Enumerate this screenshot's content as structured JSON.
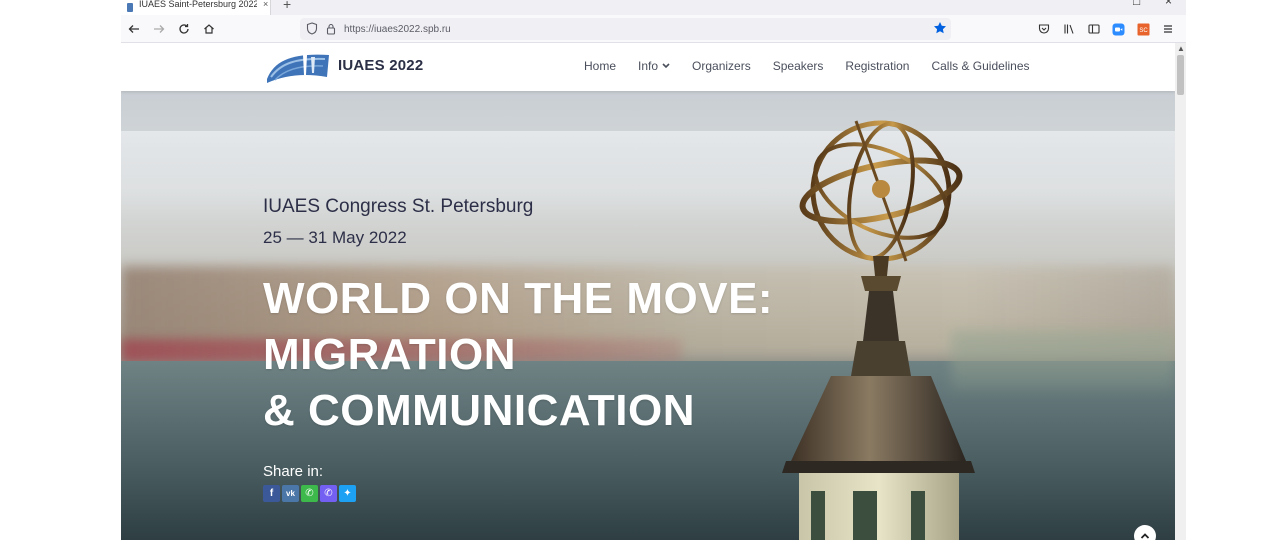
{
  "browser": {
    "tab_title": "IUAES Saint-Petersburg 2022 Co",
    "tab_close": "×",
    "new_tab": "+",
    "url": "https://iuaes2022.spb.ru",
    "window_controls": {
      "maximize": "□",
      "close": "×"
    }
  },
  "site": {
    "title": "IUAES 2022",
    "nav": [
      {
        "label": "Home"
      },
      {
        "label": "Info"
      },
      {
        "label": "Organizers"
      },
      {
        "label": "Speakers"
      },
      {
        "label": "Registration"
      },
      {
        "label": "Calls & Guidelines"
      }
    ]
  },
  "hero": {
    "subtitle": "IUAES Congress St. Petersburg",
    "dates": "25 — 31 May 2022",
    "title_line1": "WORLD ON THE MOVE:",
    "title_line2": "MIGRATION",
    "title_line3": "& COMMUNICATION",
    "share_label": "Share in:",
    "share": [
      {
        "name": "facebook",
        "glyph": "f",
        "color": "#3b5998"
      },
      {
        "name": "vk",
        "glyph": "vk",
        "color": "#4a76a8"
      },
      {
        "name": "whatsapp",
        "glyph": "✆",
        "color": "#3cb94a"
      },
      {
        "name": "viber",
        "glyph": "✆",
        "color": "#7360f2"
      },
      {
        "name": "twitter",
        "glyph": "✦",
        "color": "#1da1f2"
      }
    ]
  },
  "colors": {
    "accent_blue": "#0060df",
    "title_dark": "#2b3046",
    "nav_text": "#4a4f5c"
  }
}
